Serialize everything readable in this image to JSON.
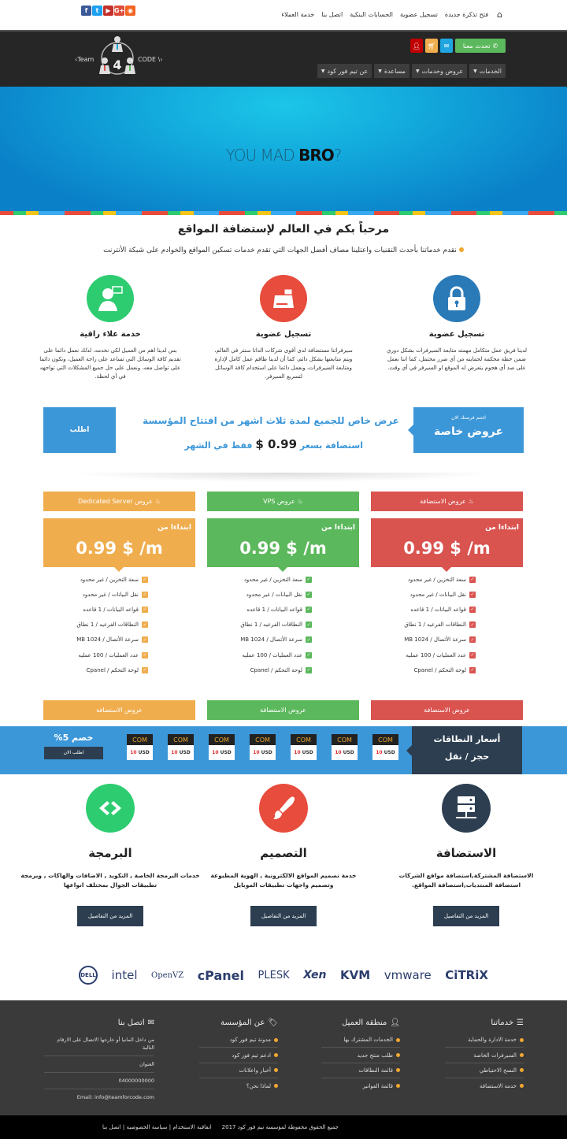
{
  "topbar": {
    "home_icon": "home-icon",
    "links": [
      "فتح تذكرة جديدة",
      "تسجيل عضوية",
      "الحسابات البنكية",
      "اتصل بنا",
      "خدمة العملاء"
    ],
    "social": [
      {
        "name": "facebook",
        "glyph": "f",
        "color": "#3b5998"
      },
      {
        "name": "twitter",
        "glyph": "t",
        "color": "#1da1f2"
      },
      {
        "name": "youtube",
        "glyph": "▶",
        "color": "#c4302b"
      },
      {
        "name": "google-plus",
        "glyph": "G+",
        "color": "#dd4b39"
      },
      {
        "name": "rss",
        "glyph": "◉",
        "color": "#f26522"
      }
    ]
  },
  "header": {
    "logo_left": "‹Team",
    "logo_right": "CODE \\›",
    "logo_mid": "4",
    "talk_label": "تحدث معنا",
    "icon_colors": {
      "mail": "#1fa5e0",
      "cart": "#f0ad4e",
      "user": "#c00000"
    },
    "menu": [
      "الخدمات",
      "عروض وخدمات",
      "مساعدة",
      "عن تيم فور كود"
    ]
  },
  "hero": {
    "text_light": "YOU MAD ",
    "text_bold": "BRO",
    "text_end": "?"
  },
  "welcome": {
    "title": "مرحباً بكم في العالم لإستضافة المواقع",
    "subtitle": "نقدم خدماتنا بأحدث التقنيات واعتلينا مصاف أفضل الجهات التي تقدم خدمات تسكين المواقع والخوادم على شبكة الأنترنت",
    "features": [
      {
        "title": "تسجيل عضوية",
        "text": "لدينا فريق عمل متكامل مهمته متابعة السيرفرات بشكل دوري ضمن خطة محكمة لحمايته من أي ضرر محتمل، كما اننا نعمل على صد أي هجوم يتعرض له الموقع او السيرفر في أي وقت.",
        "color": "#2a7ab8",
        "icon": "lock-icon"
      },
      {
        "title": "تسجيل عضوية",
        "text": "سيرفراتنا مستضافة لدى أقوى شركات الداتا سنتر في العالم، ويتم متابعتها بشكل دائم، كما أن لدينا طاقم عمل كامل لإدارة ومتابعة السيرفرات، ونعمل دائما على استخدام كافة الوسائل لتسريع السيرفر.",
        "color": "#e74c3c",
        "icon": "server-icon"
      },
      {
        "title": "خدمة علاء راقية",
        "text": "بس لدينا اهم من العميل لكي نخدمه، لذلك نعمل دائما على تقديم كافة الوسائل التي تساعد على راحة العميل، ونكون دائما على تواصل معه، ونعمل على حل جميع المشكلات التي تواجهه في أي لحظة.",
        "color": "#2ecc71",
        "icon": "support-agent-icon"
      }
    ]
  },
  "offer": {
    "badge_small": "اغتنم فرصتك الان",
    "badge_title": "عروض خاصة",
    "line1": "عرض خاص للجميع لمدة ثلاث اشهر من افتتاح المؤسسة",
    "line2_pre": "استضافة بسعر",
    "line2_price": "0.99 $",
    "line2_post": "فقط في الشهر",
    "order_label": "اطلب"
  },
  "plans": [
    {
      "title": "عروض الاستضافة",
      "color": "#d9534f",
      "from": "ابتداءا من",
      "price": "0.99 $ /m",
      "footer": "عروض الاستضافة"
    },
    {
      "title": "عروض VPS",
      "color": "#5cb85c",
      "from": "ابتداءا من",
      "price": "0.99 $ /m",
      "footer": "عروض الاستضافة"
    },
    {
      "title": "عروض Dedicated Server",
      "color": "#f0ad4e",
      "from": "ابتداءا من",
      "price": "0.99 $ /m",
      "footer": "عروض الاستضافة"
    }
  ],
  "plan_features": [
    "سعة التخزين / غير محدود",
    "نقل البيانات / غير محدود",
    "قواعد البيانات / 1 قاعده",
    "النطاقات الفرعيه / 1 نطاق",
    "سرعة الأتصال / 1024 MB",
    "عدد العمليات / 100 عمليه",
    "لوحة التحكم / Cpanel"
  ],
  "domains": {
    "title": "أسعار النطاقات",
    "subtitle": "حجز / نقل",
    "tlds": [
      {
        "name": "COM",
        "price": "10",
        "currency": "USD"
      },
      {
        "name": "COM",
        "price": "10",
        "currency": "USD"
      },
      {
        "name": "COM",
        "price": "10",
        "currency": "USD"
      },
      {
        "name": "COM",
        "price": "10",
        "currency": "USD"
      },
      {
        "name": "COM",
        "price": "10",
        "currency": "USD"
      },
      {
        "name": "COM",
        "price": "10",
        "currency": "USD"
      },
      {
        "name": "COM",
        "price": "10",
        "currency": "USD"
      }
    ],
    "discount": "خصم 5%",
    "order_now": "اطلب الان"
  },
  "services": [
    {
      "title": "الاستضافة",
      "text": "الاستضافة المشتركة,استضافة مواقع الشركات استضافة المنتديات,استضافة المواقع.",
      "button": "المزيد من التفاصيل",
      "color": "#2c3e50",
      "icon": "server-rack-icon"
    },
    {
      "title": "التصميم",
      "text": "خدمة تصميم المواقع الالكترونية , الهوية المطبوعة وتصميم واجهات تطبيقات الموبايل",
      "button": "المزيد من التفاصيل",
      "color": "#e74c3c",
      "icon": "paintbrush-icon"
    },
    {
      "title": "البرمجة",
      "text": "خدمات البرمجة الخاصة , التكويد , الاضافات والهاكات , وبرمجة تطبيقات الجوال بمختلف انواعها",
      "button": "المزيد من التفاصيل",
      "color": "#2ecc71",
      "icon": "code-icon"
    }
  ],
  "partners": [
    "DELL",
    "intel",
    "OpenVZ",
    "cPanel",
    "PLESK",
    "Xen",
    "KVM",
    "vmware",
    "CiTRiX"
  ],
  "footer": {
    "services": {
      "title": "خدماتنا",
      "items": [
        "خدمة الادارة والحماية",
        "السيرفرات الخاصة",
        "النسخ الاحتياطي",
        "خدمة الاستضافة"
      ]
    },
    "client": {
      "title": "منطقة العميل",
      "items": [
        "الخدمات المشترك بها",
        "طلب منتج جديد",
        "قائمة النطاقات",
        "قائمة الفواتير"
      ]
    },
    "about": {
      "title": "عن المؤسسة",
      "items": [
        "مدونة تيم فور كود",
        "ادعم تيم فور كود",
        "أخبار واعلانات",
        "لماذا نحن؟"
      ]
    },
    "contact": {
      "title": "اتصل بنا",
      "text": "من داخل المانيا أو خارجها الاتصال على الارقام التالية",
      "address_label": "العنوان",
      "phone": "04000000000",
      "email": "Email: info@teamforcode.com"
    },
    "copyright": "جميع الحقوق محفوظة لمؤسسة تيم فور كود 2017",
    "links": "اتفاقية الاستخدام | سياسة الخصوصية | اتصل بنا"
  }
}
